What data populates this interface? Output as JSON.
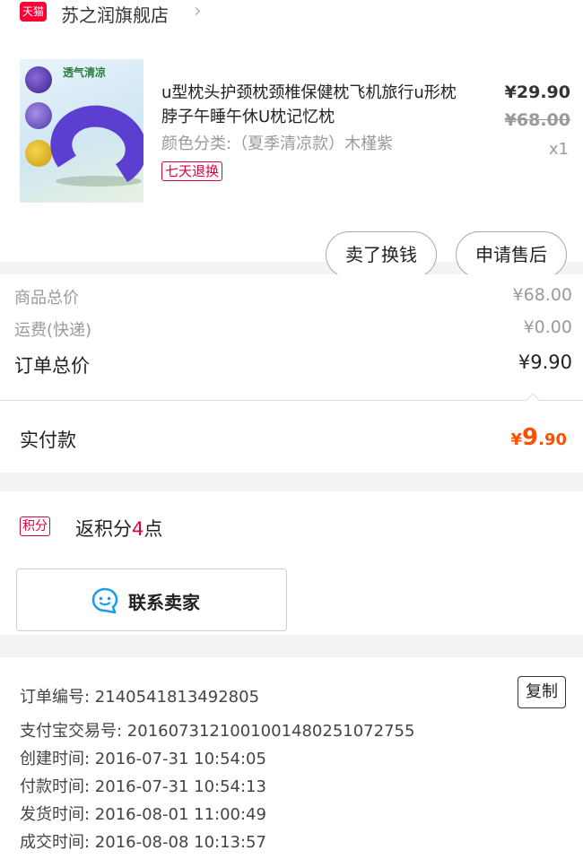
{
  "store": {
    "badge": "天猫",
    "name": "苏之润旗舰店"
  },
  "product": {
    "image_title": "透气清凉",
    "title": "u型枕头护颈枕颈椎保健枕飞机旅行u形枕脖子午睡午休U枕记忆枕",
    "sku": "颜色分类:（夏季清凉款）木槿紫",
    "return_tag": "七天退换",
    "price": "¥29.90",
    "original_price": "¥68.00",
    "quantity": "x1",
    "accent_color": "#5c3fd1"
  },
  "actions": {
    "sell_label": "卖了换钱",
    "service_label": "申请售后"
  },
  "summary": {
    "goods_label": "商品总价",
    "goods_value": "¥68.00",
    "shipping_label": "运费(快递)",
    "shipping_value": "¥0.00",
    "order_total_label": "订单总价",
    "order_total_value": "¥9.90"
  },
  "paid": {
    "label": "实付款",
    "currency": "¥",
    "integer": "9",
    "decimal": ".90",
    "color": "#ff5000"
  },
  "points": {
    "badge": "积分",
    "text_prefix": "返积分",
    "amount": "4",
    "text_suffix": "点"
  },
  "contact": {
    "icon": "chat-bubble-icon",
    "label": "联系卖家",
    "icon_color": "#1aa0e8"
  },
  "order_info": {
    "order_no": "订单编号: 2140541813492805",
    "copy_label": "复制",
    "alipay_no": "支付宝交易号: 2016073121001001480251072755",
    "created": "创建时间: 2016-07-31 10:54:05",
    "paid": "付款时间: 2016-07-31 10:54:13",
    "shipped": "发货时间: 2016-08-01 11:00:49",
    "completed": "成交时间: 2016-08-08 10:13:57"
  },
  "colors": {
    "brand_red": "#ff0036",
    "tag_red": "#e0003a"
  }
}
